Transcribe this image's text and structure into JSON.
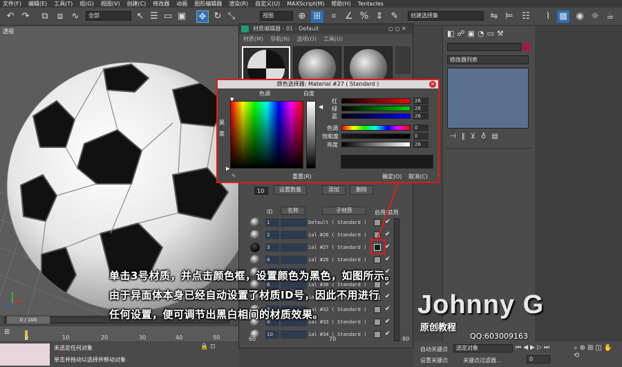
{
  "menu": [
    "文件(F)",
    "编辑(E)",
    "工具(T)",
    "组(G)",
    "视图(V)",
    "创建(C)",
    "修改器",
    "动画",
    "图形编辑器",
    "渲染(R)",
    "自定义(U)",
    "MAXScript(M)",
    "帮助(H)",
    "Tentacles"
  ],
  "toolbar": {
    "filter_select": "全部",
    "view_select": "视图",
    "selection_set": "创建选择集"
  },
  "viewport": {
    "label": "透视"
  },
  "material_editor": {
    "title": "材质编辑器 - 01 - Default",
    "menu": [
      "材质(M)",
      "导航(N)",
      "选项(O)",
      "工具(U)"
    ],
    "set_count_value": "10",
    "set_count_label": "设置数量",
    "add_label": "添加",
    "delete_label": "删除",
    "col_id": "ID",
    "col_name": "名称",
    "col_submat": "子材质",
    "col_enable": "启用/禁用",
    "rows": [
      {
        "id": "1",
        "sub": "Default  ( Standard )"
      },
      {
        "id": "2",
        "sub": "ial #26  ( Standard )"
      },
      {
        "id": "3",
        "sub": "ial #27  ( Standard )"
      },
      {
        "id": "4",
        "sub": "ial #28  ( Standard )"
      },
      {
        "id": "5",
        "sub": ""
      },
      {
        "id": "6",
        "sub": "ial #30  ( Standard )"
      },
      {
        "id": "7",
        "sub": "ial #31  ( Standard )"
      },
      {
        "id": "8",
        "sub": "ial #32  ( Standard )"
      },
      {
        "id": "9",
        "sub": "ial #33  ( Standard )"
      },
      {
        "id": "10",
        "sub": "ial #34  ( Standard )"
      }
    ]
  },
  "color_picker": {
    "title": "颜色选择器: Material #27  ( Standard )",
    "hue_label": "色调",
    "white_label": "白度",
    "black_label_1": "黑",
    "black_label_2": "度",
    "red_label": "红",
    "green_label": "绿",
    "blue_label": "蓝",
    "hue2_label": "色调",
    "sat_label": "饱和度",
    "val_label": "亮度",
    "red": "26",
    "green": "26",
    "blue": "26",
    "hue": "0",
    "sat": "0",
    "value": "26",
    "reset_label": "重置(R)",
    "ok_label": "确定(O)",
    "cancel_label": "取消(C)"
  },
  "command_panel": {
    "modifier_list": "修改器列表"
  },
  "timeline": {
    "frame": "0 / 100",
    "ticks": [
      "0",
      "10",
      "20",
      "30",
      "40",
      "50",
      "60",
      "70",
      "80"
    ]
  },
  "status": {
    "line1": "未选定任何对象",
    "line2": "单击并拖动以选择并移动对象"
  },
  "bottom_right": {
    "autokey": "自动关键点",
    "selected_obj": "选定对象",
    "setkey": "设置关键点",
    "key_filters": "关键点过滤器...",
    "frame_value": "0"
  },
  "caption": {
    "line1": "单击3号材质，并点击颜色框，设置颜色为黑色，如图所示。",
    "line2": "由于异面体本身已经自动设置了材质ID号，因此不用进行",
    "line3": "任何设置，便可调节出黑白相间的材质效果。"
  },
  "watermark": {
    "name": "Johnny G",
    "sub": "原创教程",
    "qq": "QQ:603009163"
  },
  "colors": {
    "highlight_red": "#e21b1b",
    "picked_color": "#1a1a1a"
  }
}
